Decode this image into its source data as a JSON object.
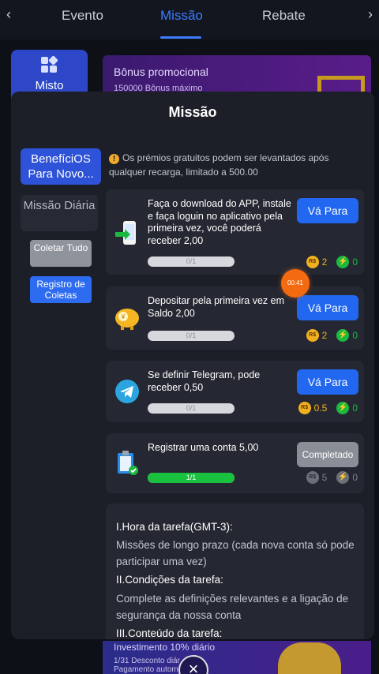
{
  "topbar": {
    "tabs": [
      "Evento",
      "Missão",
      "Rebate"
    ],
    "active_tab": "Missão"
  },
  "background": {
    "misto_label": "Misto",
    "banner_title": "Bônus promocional",
    "banner_sub": "150000 Bônus máximo",
    "banner2_title": "Investimento 10% diário",
    "banner2_line1": "1/31 Desconto diár",
    "banner2_line2": "Pagamento autom"
  },
  "modal": {
    "title": "Missão",
    "sidebar": {
      "beneficios": "BenefíciOS Para Novo...",
      "missao_diaria": "Missão Diária",
      "coletar_tudo": "Coletar Tudo",
      "registro": "Registro de Coletas"
    },
    "notice": "Os prémios gratuitos podem ser levantados após qualquer recarga, limitado a 500.00",
    "tasks": [
      {
        "desc": "Faça o download do APP, instale e faça loguin no aplicativo pela primeira vez, você poderá receber 2,00",
        "button": "Vá Para",
        "progress_label": "0/1",
        "progress": 0,
        "coin": "2",
        "bolt": "0"
      },
      {
        "desc": "Depositar pela primeira vez em Saldo 2,00",
        "button": "Vá Para",
        "progress_label": "0/1",
        "progress": 0,
        "coin": "2",
        "bolt": "0"
      },
      {
        "desc": "Se definir Telegram, pode receber 0,50",
        "button": "Vá Para",
        "progress_label": "0/1",
        "progress": 0,
        "coin": "0.5",
        "bolt": "0"
      },
      {
        "desc": "Registrar uma conta 5,00",
        "button": "Completado",
        "progress_label": "1/1",
        "progress": 1,
        "coin": "5",
        "bolt": "0"
      }
    ],
    "rules": {
      "h1": "I.Hora da tarefa(GMT-3):",
      "p1": "Missões de longo prazo (cada nova conta só pode participar uma vez)",
      "h2": "II.Condições da tarefa:",
      "p2": "Complete as definições relevantes e a ligação de segurança da nossa conta",
      "h3": "III.Conteúdo da tarefa:"
    }
  },
  "timer": "00:41",
  "coin_symbol": "R$",
  "bolt_symbol": "⚡",
  "colors": {
    "accent": "#2167f0",
    "gold": "#f2b01e",
    "green": "#1bb940",
    "timer": "#f36a10"
  }
}
